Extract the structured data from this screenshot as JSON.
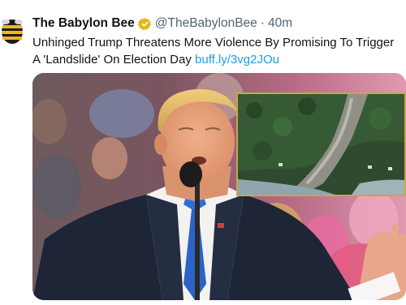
{
  "tweet": {
    "display_name": "The Babylon Bee",
    "handle": "@TheBabylonBee",
    "separator": "·",
    "time": "40m",
    "text": "Unhinged Trump Threatens More Violence By Promising To Trigger A 'Landslide' On Election Day ",
    "link_text": "buff.ly/3vg2JOu"
  },
  "icons": {
    "avatar": "babylon-bee-logo",
    "verified": "verified-badge-gold"
  },
  "colors": {
    "link": "#1d9bf0",
    "verified_badge": "#e2b719",
    "secondary_text": "#536471",
    "inset_border": "#c9a64a"
  }
}
